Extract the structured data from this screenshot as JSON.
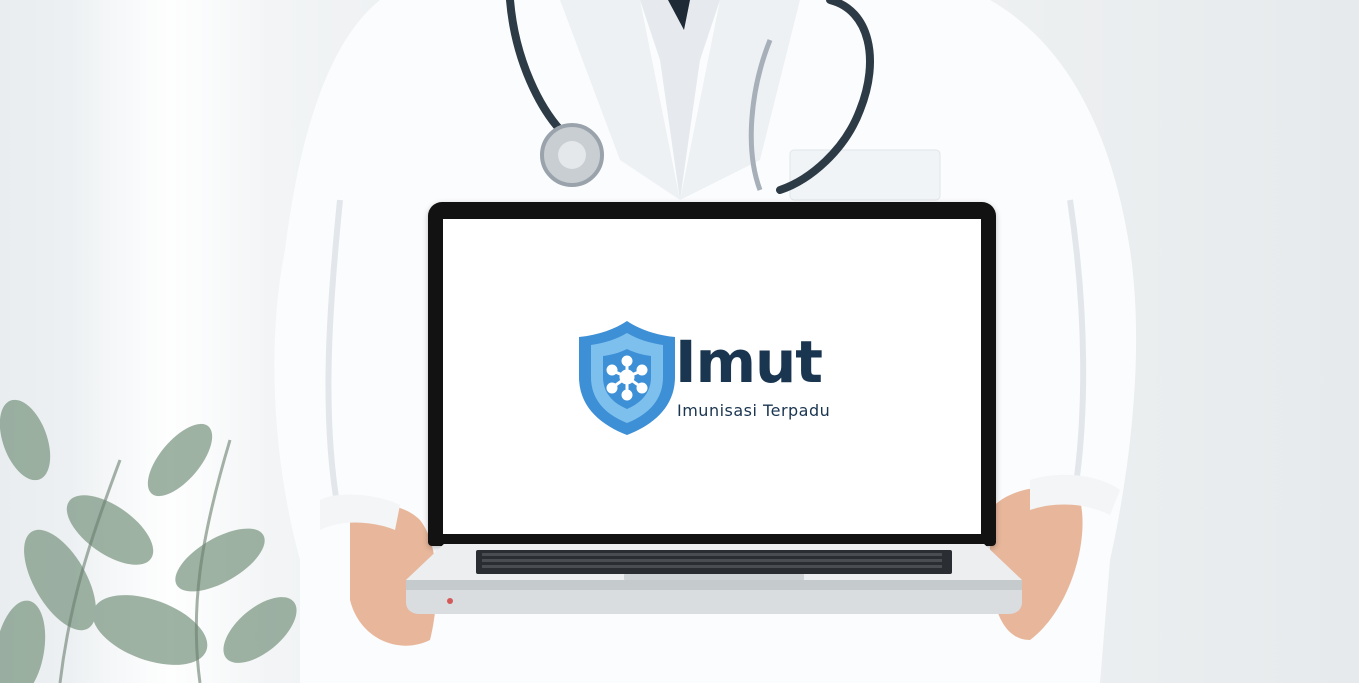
{
  "brand": {
    "name": "Imut",
    "tagline": "Imunisasi Terpadu"
  },
  "colors": {
    "shield_outer": "#3d8fd6",
    "shield_inner": "#7dc0ee",
    "brand_text": "#1a3550",
    "screen_bg": "#ffffff",
    "bezel": "#121212"
  },
  "icons": {
    "logo_icon": "shield-molecule-icon"
  }
}
